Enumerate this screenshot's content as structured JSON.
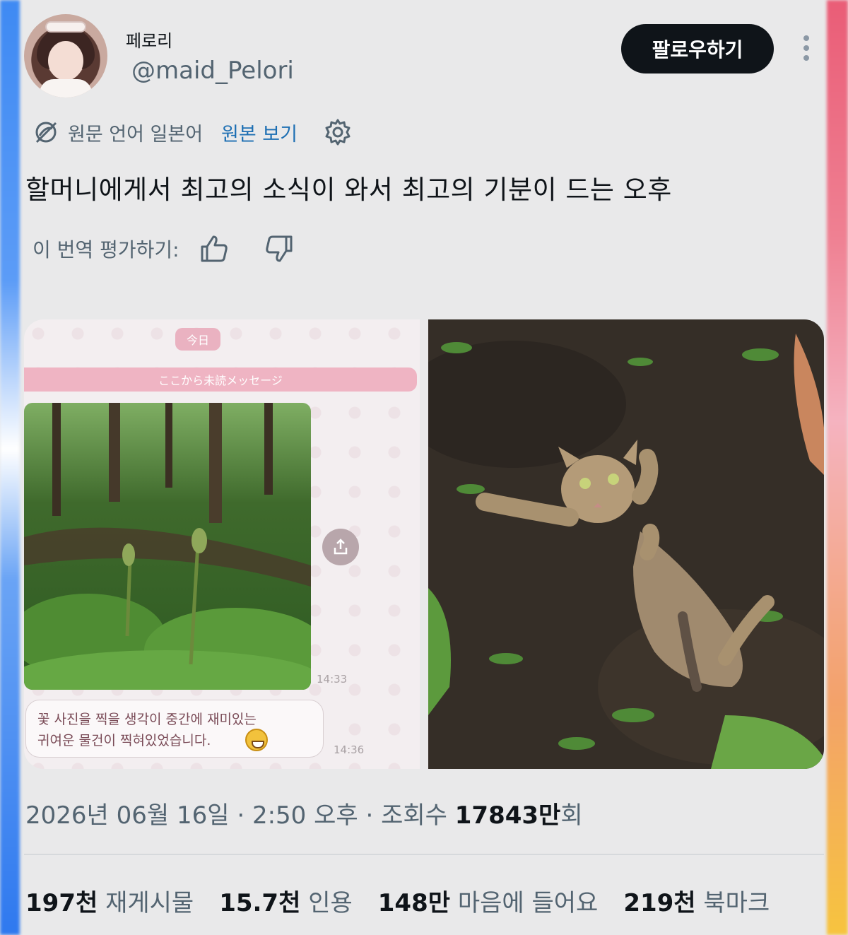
{
  "user": {
    "display_name": "페로리",
    "handle": "@maid_Pelori",
    "follow_label": "팔로우하기"
  },
  "translation": {
    "original_language": "원문 언어 일본어",
    "view_original": "원본 보기",
    "rate_label": "이 번역 평가하기:"
  },
  "tweet": {
    "text": "할머니에게서 최고의 소식이 와서 최고의 기분이 드는 오후"
  },
  "media": {
    "chat": {
      "today": "今日",
      "unread": "ここから未読メッセージ",
      "time1": "14:33",
      "message_line1": "꽃 사진을 찍을 생각이 중간에 재미있는",
      "message_line2": "귀여운 물건이 찍혀있었습니다.",
      "time2": "14:36"
    }
  },
  "meta": {
    "date": "2026년 06월 16일",
    "sep1": " · ",
    "time": "2:50 오후",
    "sep2": " · ",
    "views_label": "조회수 ",
    "views_value": "17843만",
    "views_suffix": "회"
  },
  "stats": [
    {
      "value": "197천",
      "label": "재게시물"
    },
    {
      "value": "15.7천",
      "label": "인용"
    },
    {
      "value": "148만",
      "label": "마음에 들어요"
    },
    {
      "value": "219천",
      "label": "북마크"
    }
  ],
  "colors": {
    "follow_bg": "#0f1419",
    "link": "#1d6fb3",
    "muted": "#536471",
    "page_bg": "#e9e9ea"
  }
}
